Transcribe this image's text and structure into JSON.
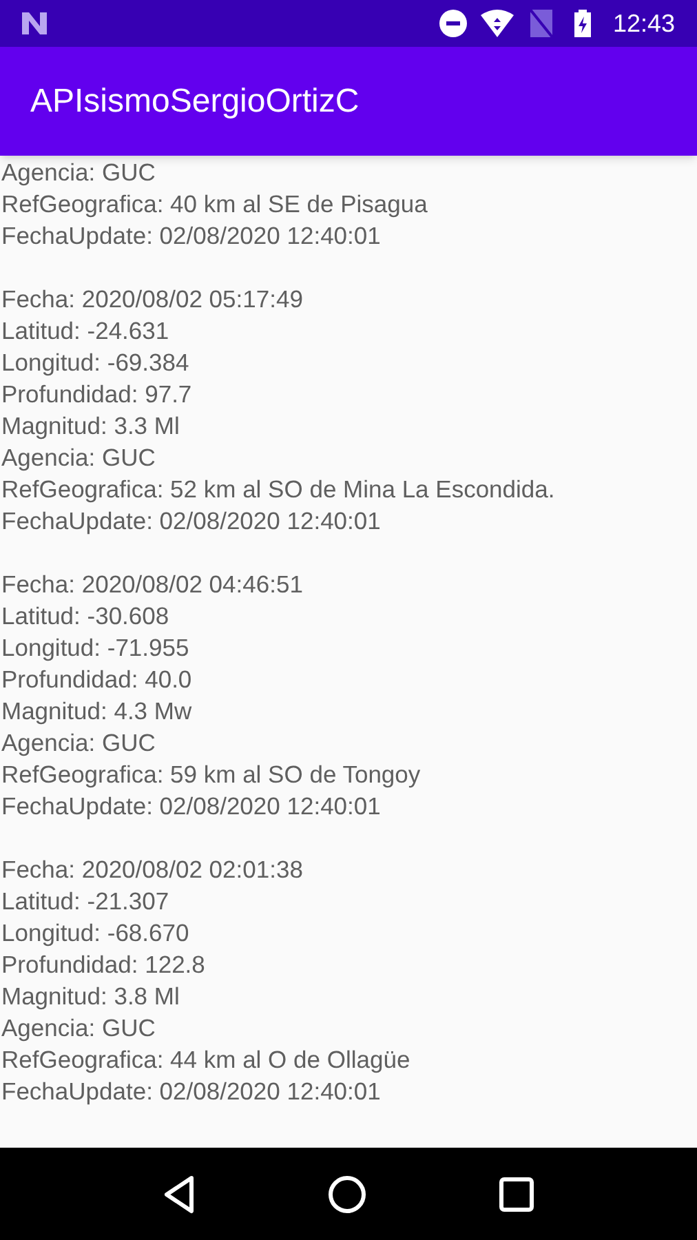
{
  "status_bar": {
    "time": "12:43"
  },
  "app_bar": {
    "title": "APIsismoSergioOrtizC"
  },
  "records": [
    {
      "lines": [
        "Agencia: GUC",
        "RefGeografica: 40 km al SE de Pisagua",
        "FechaUpdate: 02/08/2020 12:40:01"
      ]
    },
    {
      "lines": [
        "Fecha: 2020/08/02 05:17:49",
        "Latitud: -24.631",
        "Longitud: -69.384",
        "Profundidad: 97.7",
        "Magnitud: 3.3 Ml",
        "Agencia: GUC",
        "RefGeografica: 52 km al SO de Mina La Escondida.",
        "FechaUpdate: 02/08/2020 12:40:01"
      ]
    },
    {
      "lines": [
        "Fecha: 2020/08/02 04:46:51",
        "Latitud: -30.608",
        "Longitud: -71.955",
        "Profundidad: 40.0",
        "Magnitud: 4.3 Mw",
        "Agencia: GUC",
        "RefGeografica: 59 km al SO de Tongoy",
        "FechaUpdate: 02/08/2020 12:40:01"
      ]
    },
    {
      "lines": [
        "Fecha: 2020/08/02 02:01:38",
        "Latitud: -21.307",
        "Longitud: -68.670",
        "Profundidad: 122.8",
        "Magnitud: 3.8 Ml",
        "Agencia: GUC",
        "RefGeografica: 44 km al O de Ollagüe",
        "FechaUpdate: 02/08/2020 12:40:01"
      ]
    }
  ]
}
